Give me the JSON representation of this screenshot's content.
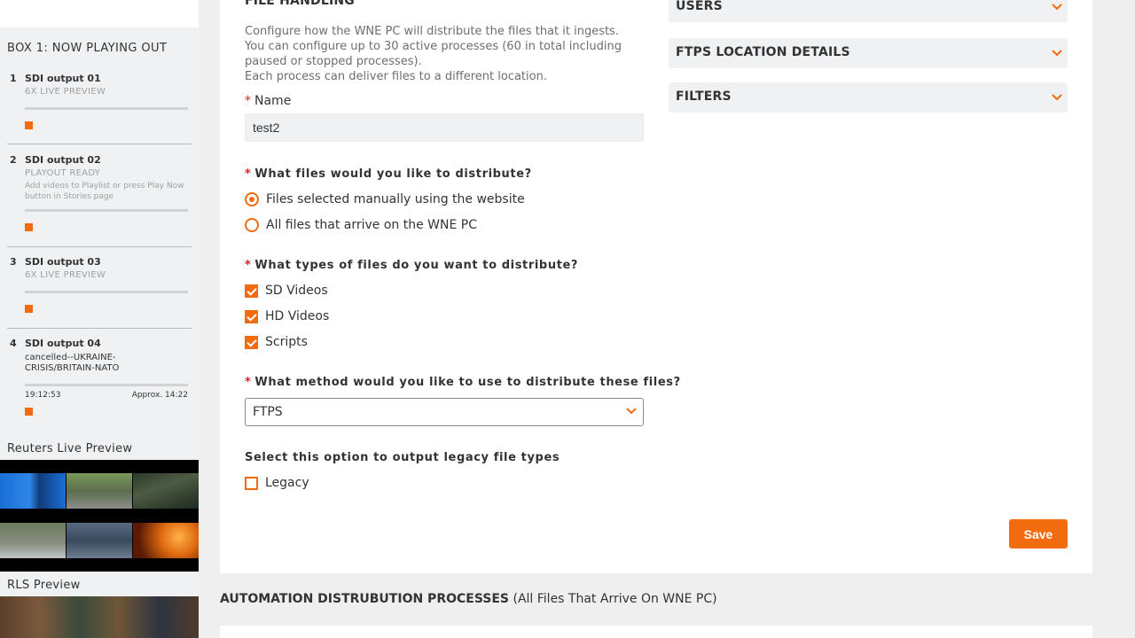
{
  "sidebar": {
    "box_title": "BOX 1: NOW PLAYING OUT",
    "outputs": [
      {
        "num": "1",
        "name": "SDI output 01",
        "status": "6X LIVE PREVIEW"
      },
      {
        "num": "2",
        "name": "SDI output 02",
        "status": "PLAYOUT READY",
        "sub": "Add videos to Playlist or press Play Now button in Stories page"
      },
      {
        "num": "3",
        "name": "SDI output 03",
        "status": "6X LIVE PREVIEW"
      },
      {
        "num": "4",
        "name": "SDI output 04",
        "story": "cancelled--UKRAINE-CRISIS/BRITAIN-NATO",
        "time": "19:12:53",
        "approx": "Approx. 14:22"
      }
    ],
    "reuters_title": "Reuters Live Preview",
    "rls_title": "RLS Preview"
  },
  "form": {
    "section_title": "FILE HANDLING",
    "description": [
      "Configure how the WNE PC will distribute the files that it ingests.",
      "You can configure up to 30 active processes (60 in total including",
      "paused or stopped processes).",
      "Each process can deliver files to a different location."
    ],
    "required_mark": "*",
    "name_label": "Name",
    "name_value": "test2",
    "q_distribute": "What files would you like to distribute?",
    "radio_manual": "Files selected manually using the website",
    "radio_all": "All files that arrive on the WNE PC",
    "q_types": "What types of files do you want to distribute?",
    "check_sd": "SD Videos",
    "check_hd": "HD Videos",
    "check_scripts": "Scripts",
    "q_method": "What method would you like to use to distribute these files?",
    "method_value": "FTPS",
    "legacy_heading": "Select this option to output legacy file types",
    "legacy_label": "Legacy",
    "save_label": "Save"
  },
  "accordions": [
    "USERS",
    "FTPS LOCATION DETAILS",
    "FILTERS"
  ],
  "automation": {
    "title": "AUTOMATION DISTRUBUTION PROCESSES",
    "subtitle": "(All Files That Arrive On WNE PC)"
  },
  "colors": {
    "accent": "#f26b0f",
    "required": "#e31d1d",
    "panel_bg": "#f0f1f2"
  },
  "icons": {
    "accordion": "chevron-down-icon",
    "select": "chevron-down-icon",
    "stop": "stop-square-icon"
  }
}
